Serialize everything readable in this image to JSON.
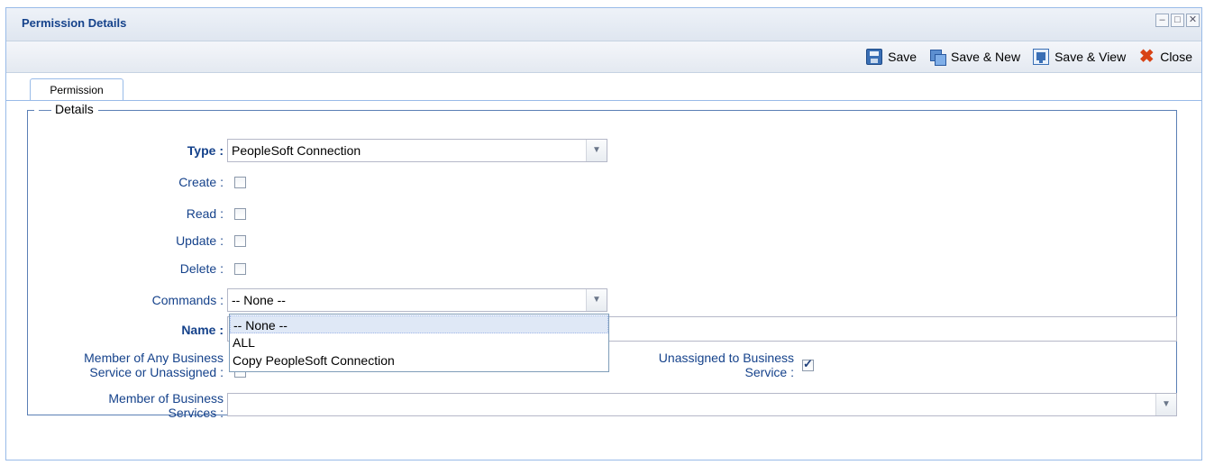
{
  "window": {
    "title": "Permission Details",
    "controls": {
      "minimize": "–",
      "maximize": "□",
      "close": "✕"
    }
  },
  "toolbar": {
    "save_label": "Save",
    "save_new_label": "Save & New",
    "save_view_label": "Save & View",
    "close_label": "Close"
  },
  "tabs": [
    {
      "label": "Permission",
      "active": true
    }
  ],
  "details": {
    "legend": "Details",
    "type": {
      "label": "Type :",
      "value": "PeopleSoft Connection"
    },
    "create": {
      "label": "Create :",
      "checked": false
    },
    "read": {
      "label": "Read :",
      "checked": false
    },
    "update": {
      "label": "Update :",
      "checked": false
    },
    "delete": {
      "label": "Delete :",
      "checked": false
    },
    "commands": {
      "label": "Commands :",
      "value": "-- None --",
      "options": [
        "-- None --",
        "ALL",
        "Copy PeopleSoft Connection"
      ],
      "selected_index": 0
    },
    "name": {
      "label": "Name :",
      "value": ""
    },
    "member_any": {
      "label_line1": "Member of Any Business",
      "label_line2": "Service or Unassigned :",
      "checked": false
    },
    "unassigned": {
      "label_line1": "Unassigned to Business",
      "label_line2": "Service :",
      "checked": true
    },
    "member_services": {
      "label_line1": "Member of Business",
      "label_line2": "Services :",
      "value": ""
    }
  },
  "colors": {
    "accent": "#15428b",
    "border": "#99bbe8"
  }
}
